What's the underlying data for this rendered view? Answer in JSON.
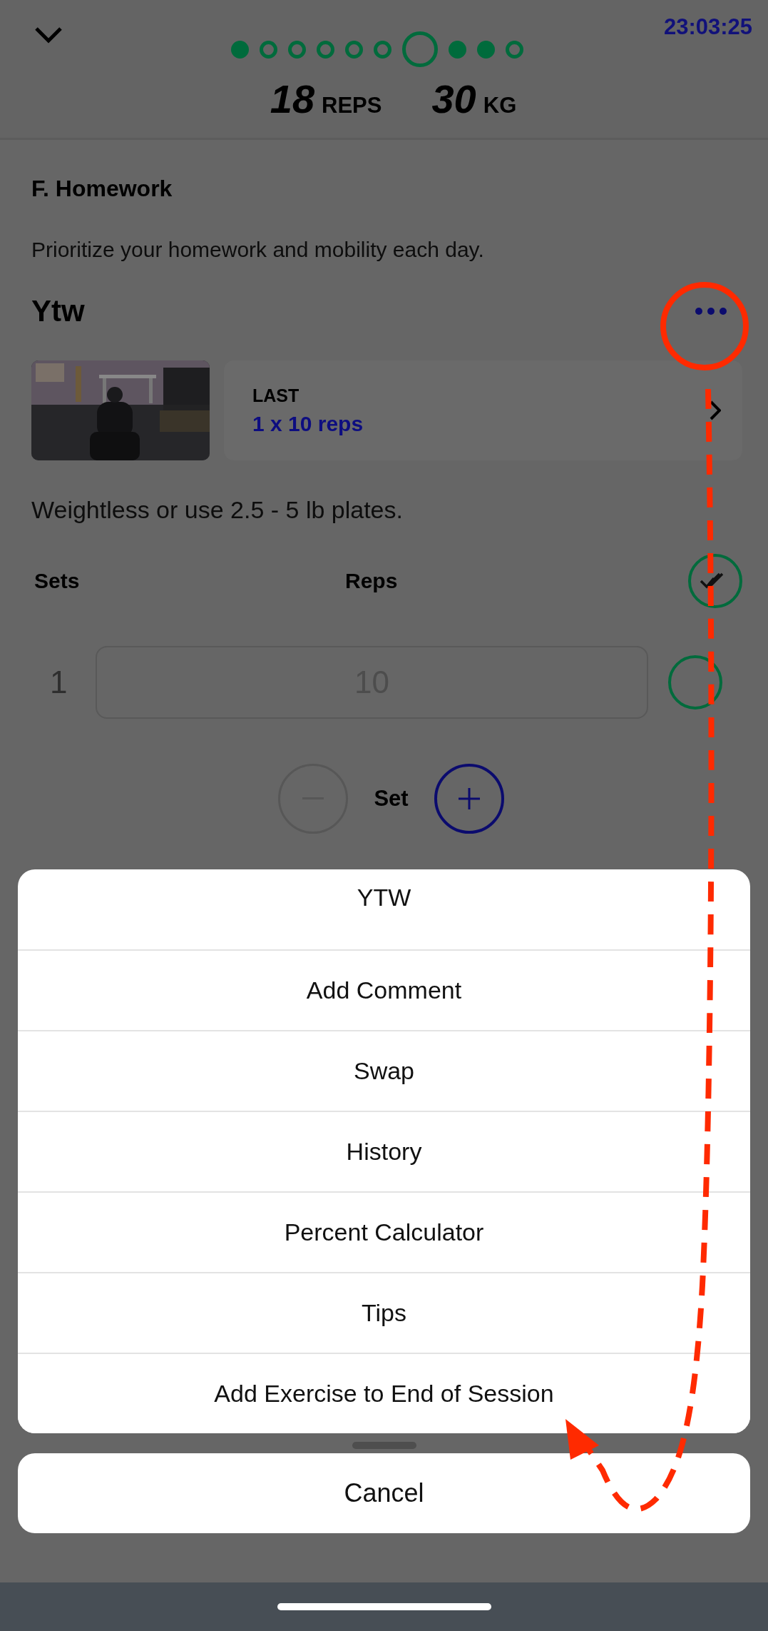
{
  "header": {
    "time": "23:03:25",
    "progress_dots": [
      {
        "done": true,
        "selected": false
      },
      {
        "done": false,
        "selected": false
      },
      {
        "done": false,
        "selected": false
      },
      {
        "done": false,
        "selected": false
      },
      {
        "done": false,
        "selected": false
      },
      {
        "done": false,
        "selected": false
      },
      {
        "done": false,
        "selected": true
      },
      {
        "done": true,
        "selected": false
      },
      {
        "done": true,
        "selected": false
      },
      {
        "done": false,
        "selected": false
      }
    ],
    "stats": [
      {
        "value": "18",
        "unit": "REPS"
      },
      {
        "value": "30",
        "unit": "KG"
      }
    ]
  },
  "section": {
    "title": "F. Homework",
    "description": "Prioritize your homework and mobility each day."
  },
  "exercise": {
    "name": "Ytw",
    "last": {
      "label": "LAST",
      "value": "1 x 10 reps"
    },
    "note": "Weightless or use 2.5 - 5 lb plates.",
    "columns": [
      "Sets",
      "Reps"
    ],
    "all_checked": false,
    "sets": [
      {
        "number": "1",
        "reps": "10",
        "checked": false
      }
    ],
    "set_label": "Set"
  },
  "action_sheet": {
    "title": "YTW",
    "items": [
      "Add Comment",
      "Swap",
      "History",
      "Percent Calculator",
      "Tips",
      "Add Exercise to End of Session"
    ],
    "cancel": "Cancel"
  }
}
